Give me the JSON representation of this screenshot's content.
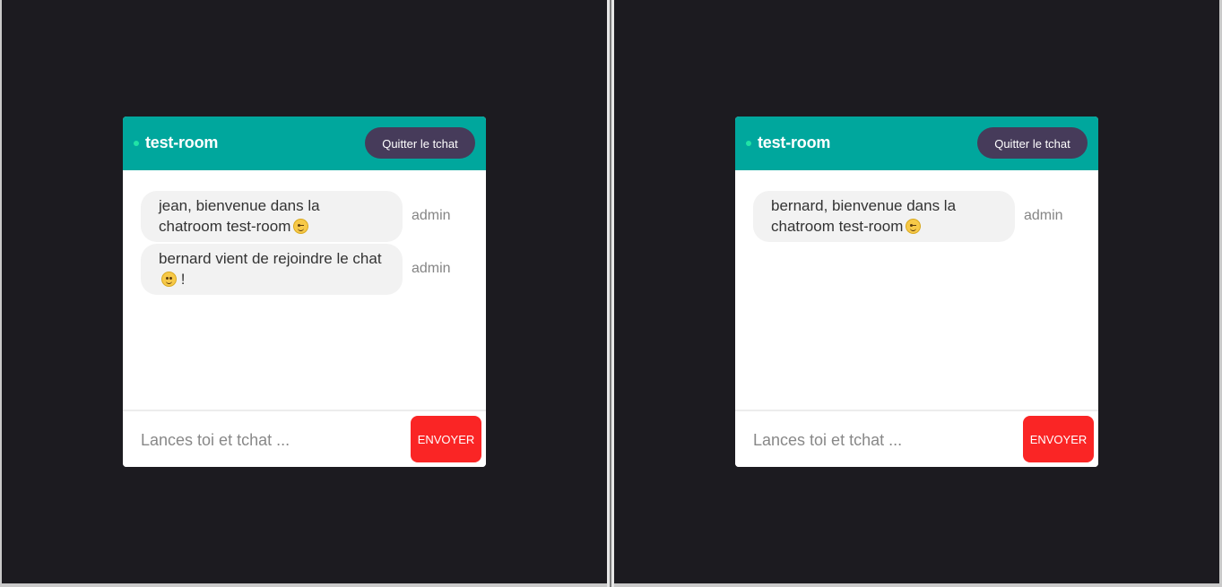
{
  "panes": [
    {
      "room": "test-room",
      "quit_label": "Quitter le tchat",
      "messages": [
        {
          "text": "jean, bienvenue dans la chatroom test-room",
          "emoji": "wink-face-icon",
          "suffix": "",
          "sender": "admin"
        },
        {
          "text": "bernard vient de rejoindre le chat",
          "emoji": "smiling-face-icon",
          "suffix": " !",
          "sender": "admin"
        }
      ],
      "input_placeholder": "Lances toi et tchat ...",
      "send_label": "ENVOYER"
    },
    {
      "room": "test-room",
      "quit_label": "Quitter le tchat",
      "messages": [
        {
          "text": "bernard, bienvenue dans la chatroom test-room",
          "emoji": "wink-face-icon",
          "suffix": "",
          "sender": "admin"
        }
      ],
      "input_placeholder": "Lances toi et tchat ...",
      "send_label": "ENVOYER"
    }
  ],
  "colors": {
    "background": "#1c1b20",
    "header": "#00a79d",
    "status_dot": "#20e3a6",
    "quit_button": "#463b5a",
    "send_button": "#fa2525",
    "bubble": "#f2f2f2"
  }
}
